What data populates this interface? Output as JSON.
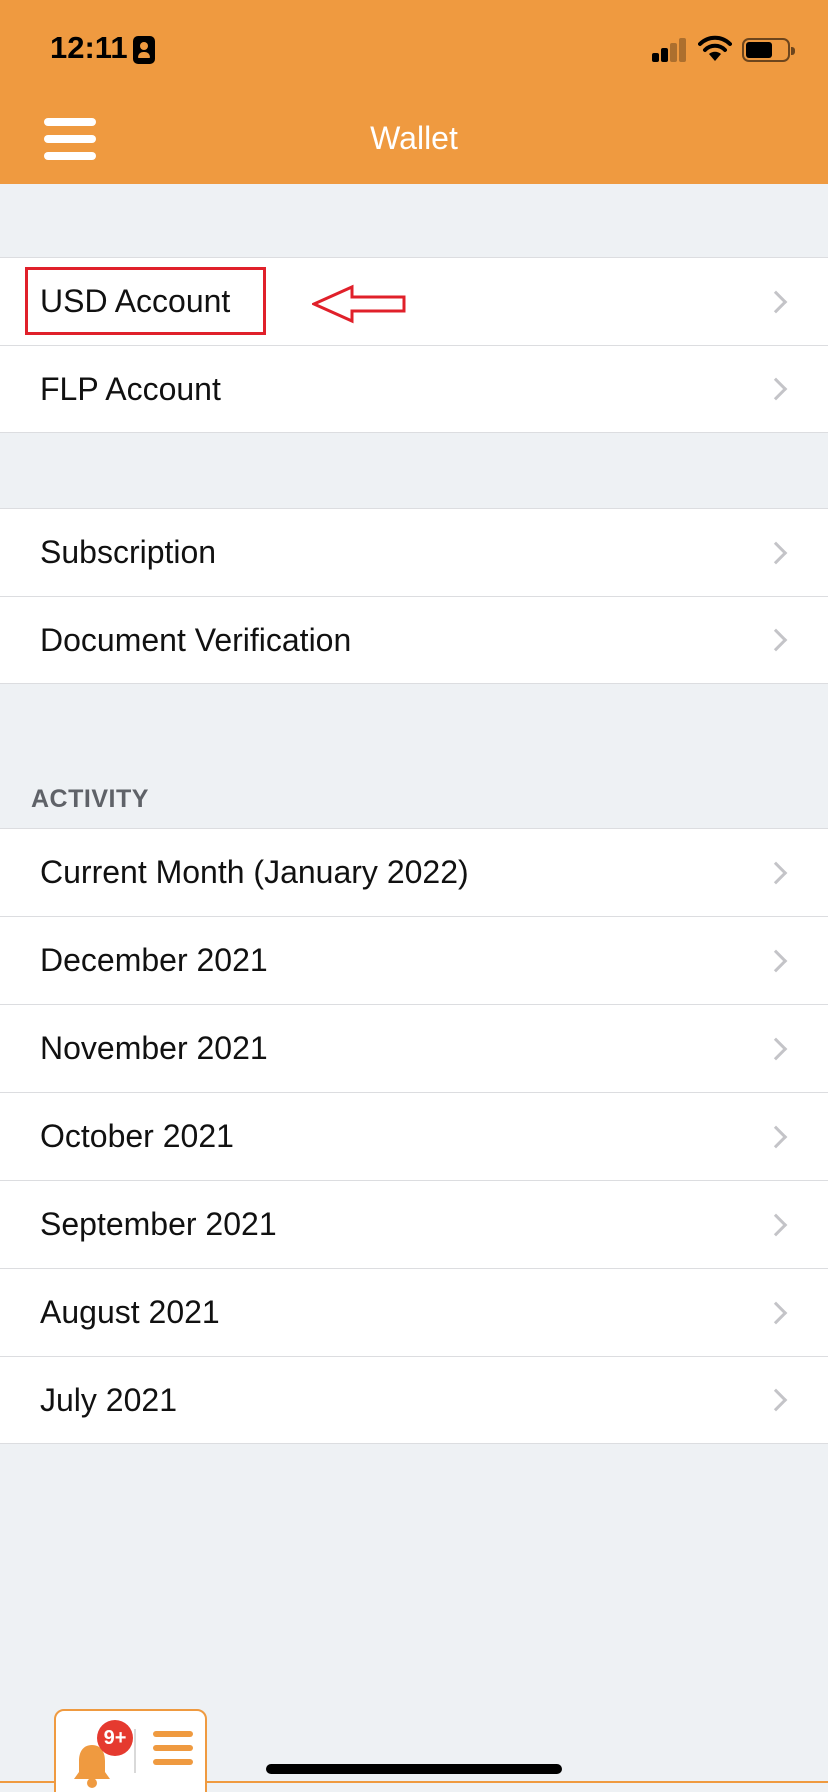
{
  "status_bar": {
    "time": "12:11"
  },
  "header": {
    "title": "Wallet"
  },
  "accounts": [
    {
      "label": "USD Account"
    },
    {
      "label": "FLP Account"
    }
  ],
  "services": [
    {
      "label": "Subscription"
    },
    {
      "label": "Document Verification"
    }
  ],
  "activity": {
    "header": "ACTIVITY",
    "items": [
      {
        "label": "Current Month (January 2022)"
      },
      {
        "label": "December 2021"
      },
      {
        "label": "November 2021"
      },
      {
        "label": "October 2021"
      },
      {
        "label": "September 2021"
      },
      {
        "label": "August 2021"
      },
      {
        "label": "July 2021"
      }
    ]
  },
  "dock": {
    "notification_count": "9+"
  },
  "colors": {
    "brand": "#ef9a40",
    "annotation": "#e0202a",
    "badge": "#e53a2f",
    "background": "#eef1f4"
  }
}
